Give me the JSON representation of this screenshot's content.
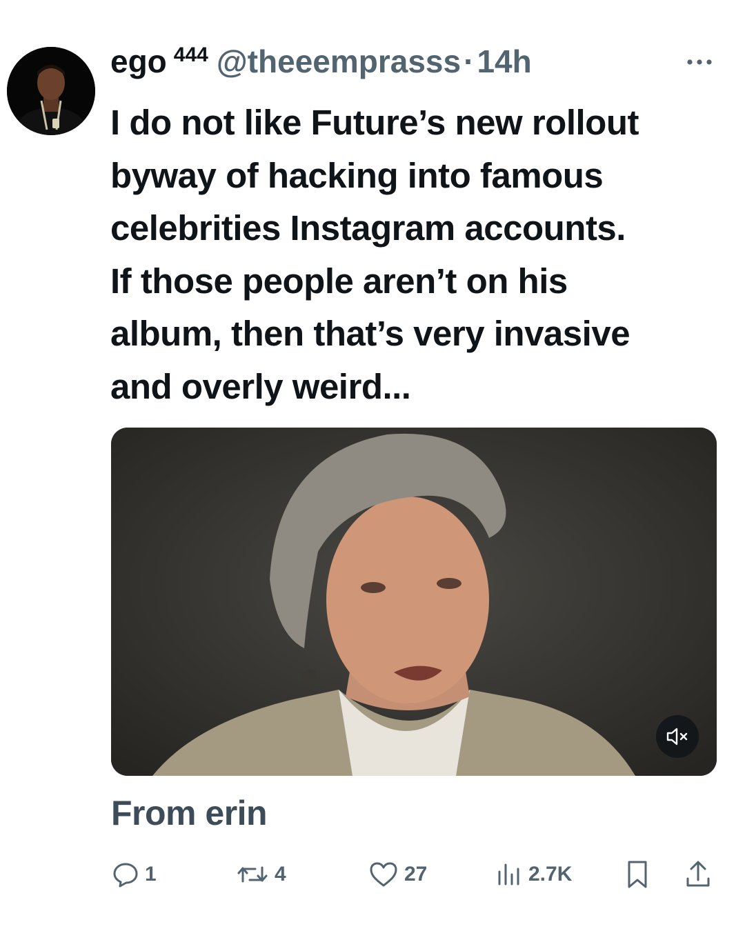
{
  "tweet": {
    "display_name": "ego",
    "display_name_sup": "444",
    "handle": "@theeemprasss",
    "separator": "·",
    "timestamp": "14h",
    "text": "I do not like Future’s new rollout\nbyway of hacking into famous\ncelebrities Instagram accounts.\nIf those people aren’t on his\nalbum, then that’s very invasive\nand overly weird...",
    "from_label": "From erin"
  },
  "metrics": {
    "replies": "1",
    "reposts": "4",
    "likes": "27",
    "views": "2.7K"
  },
  "icons": {
    "more": "more-icon",
    "mute": "volume-muted-icon",
    "reply": "reply-icon",
    "repost": "repost-icon",
    "like": "heart-icon",
    "views": "views-icon",
    "bookmark": "bookmark-icon",
    "share": "share-icon"
  },
  "colors": {
    "text": "#0f1419",
    "secondary": "#536471",
    "media_bg": "#2e2d2b"
  }
}
